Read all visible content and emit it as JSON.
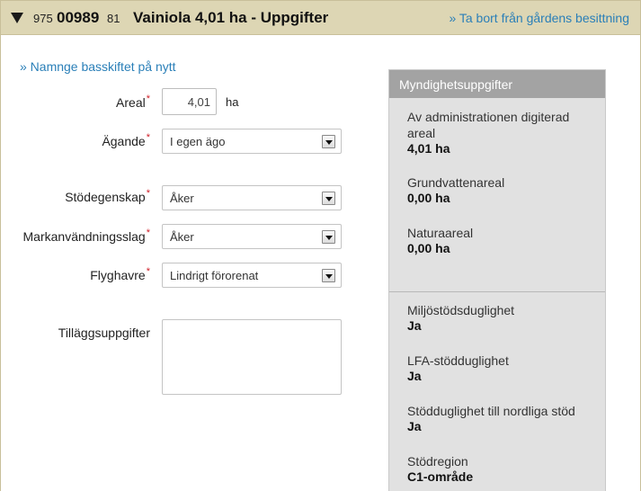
{
  "header": {
    "id_prefix": "975",
    "id_main": "00989",
    "id_suffix": "81",
    "title": "Vainiola 4,01 ha - Uppgifter",
    "remove_link": "» Ta bort från gårdens besittning"
  },
  "rename_link": "» Namnge basskiftet på nytt",
  "form": {
    "areal_label": "Areal",
    "areal_value": "4,01",
    "areal_unit": "ha",
    "agande_label": "Ägande",
    "agande_value": "I egen ägo",
    "stodegenskap_label": "Stödegenskap",
    "stodegenskap_value": "Åker",
    "markanvandning_label": "Markanvändningsslag",
    "markanvandning_value": "Åker",
    "flyghavre_label": "Flyghavre",
    "flyghavre_value": "Lindrigt förorenat",
    "tillagg_label": "Tilläggsuppgifter",
    "tillagg_value": "",
    "required_mark": "*"
  },
  "authority": {
    "title": "Myndighetsuppgifter",
    "items": [
      {
        "label": "Av administrationen digiterad areal",
        "value": "4,01 ha"
      },
      {
        "label": "Grundvattenareal",
        "value": "0,00 ha"
      },
      {
        "label": "Naturaareal",
        "value": "0,00 ha"
      },
      {
        "label": "Miljöstödsduglighet",
        "value": "Ja"
      },
      {
        "label": "LFA-stödduglighet",
        "value": "Ja"
      },
      {
        "label": "Stödduglighet till nordliga stöd",
        "value": "Ja"
      },
      {
        "label": "Stödregion",
        "value": "C1-område"
      }
    ]
  },
  "colors": {
    "header_bg": "#ddd6b4",
    "link": "#2a7fb8",
    "required": "#d0202a",
    "info_bg": "#e1e1e1",
    "info_head_bg": "#a3a3a3"
  }
}
